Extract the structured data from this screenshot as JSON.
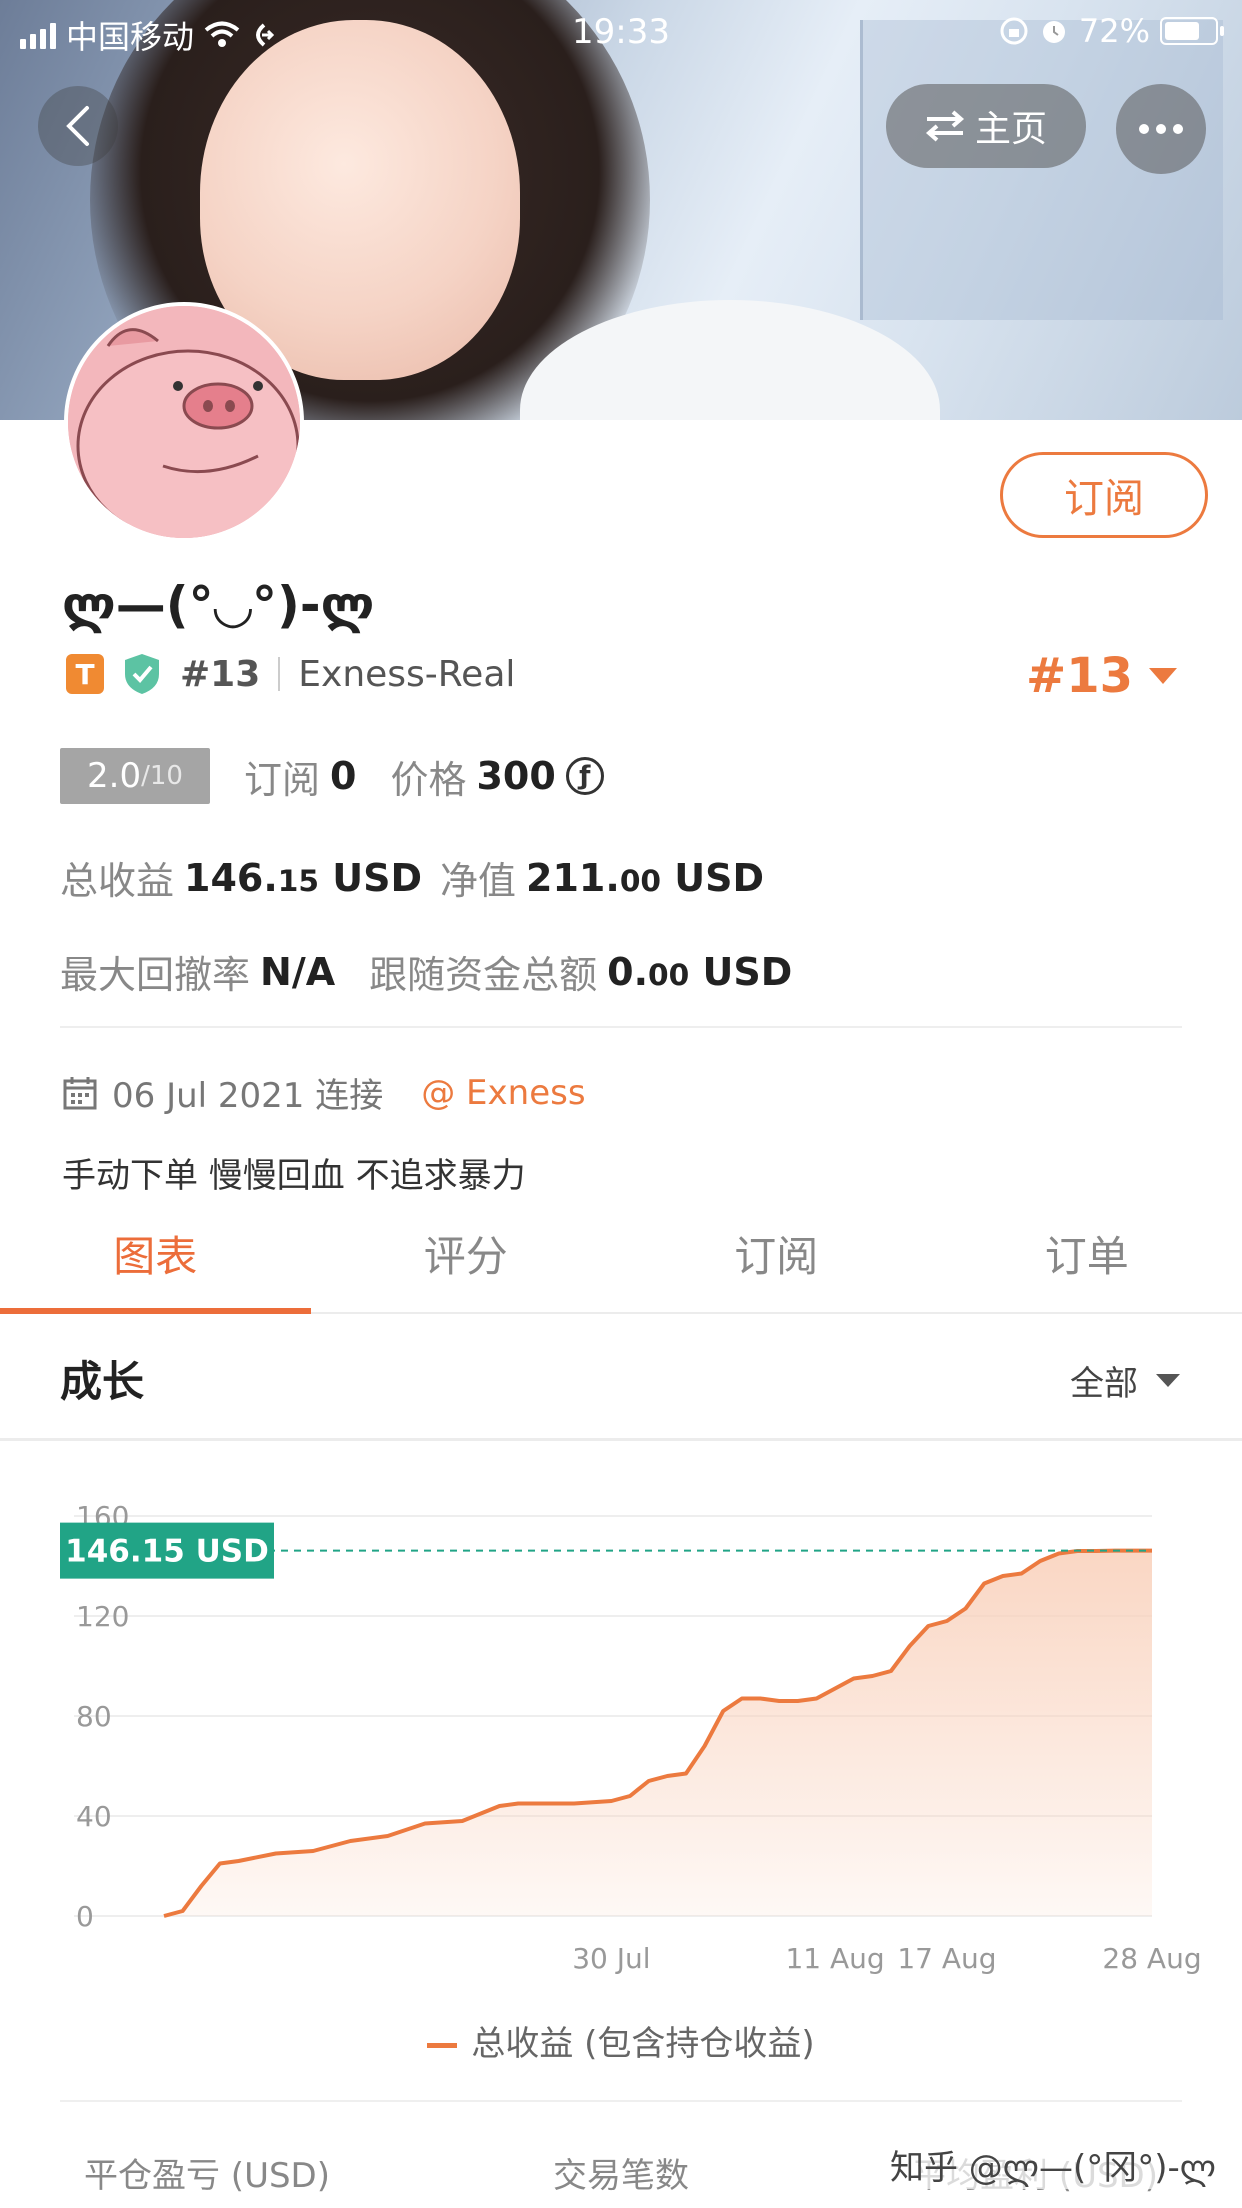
{
  "status_bar": {
    "carrier": "中国移动",
    "time": "19:33",
    "battery": "72%"
  },
  "header": {
    "home_label": "主页"
  },
  "profile": {
    "nickname": "ლ—(°◡°)-ლ",
    "badge_letter": "T",
    "rank": "#13",
    "server": "Exness-Real",
    "rank_big": "#13",
    "subscribe_label": "订阅"
  },
  "stats": {
    "score": "2.0",
    "score_max": "/10",
    "subs_label": "订阅",
    "subs_value": "0",
    "price_label": "价格",
    "price_value": "300",
    "coin_symbol": "ƒ",
    "total_profit_label": "总收益",
    "total_profit_int": "146.",
    "total_profit_dec": "15",
    "total_profit_unit": "USD",
    "equity_label": "净值",
    "equity_int": "211.",
    "equity_dec": "00",
    "equity_unit": "USD",
    "drawdown_label": "最大回撤率",
    "drawdown_value": "N/A",
    "follow_label": "跟随资金总额",
    "follow_int": "0.",
    "follow_dec": "00",
    "follow_unit": "USD"
  },
  "connection": {
    "date_text": "06 Jul 2021 连接",
    "broker": "@ Exness"
  },
  "bio": "手动下单 慢慢回血 不追求暴力",
  "tabs": [
    "图表",
    "评分",
    "订阅",
    "订单"
  ],
  "growth": {
    "title": "成长",
    "filter": "全部"
  },
  "chart_data": {
    "type": "area",
    "current_label": "146.15 USD",
    "current_value": 146.15,
    "ylim": [
      0,
      160
    ],
    "yticks": [
      0,
      40,
      80,
      120,
      160
    ],
    "xticks": [
      {
        "label": "30 Jul",
        "x": 24
      },
      {
        "label": "11 Aug",
        "x": 36
      },
      {
        "label": "17 Aug",
        "x": 42
      },
      {
        "label": "28 Aug",
        "x": 53
      }
    ],
    "xlim": [
      0,
      53
    ],
    "x": [
      0,
      1,
      2,
      3,
      4,
      6,
      8,
      10,
      12,
      14,
      16,
      18,
      19,
      20,
      22,
      24,
      25,
      26,
      27,
      28,
      29,
      30,
      31,
      32,
      33,
      34,
      35,
      36,
      37,
      38,
      39,
      40,
      41,
      42,
      43,
      44,
      45,
      46,
      47,
      48,
      49,
      50,
      51,
      52,
      53
    ],
    "values": [
      0,
      2,
      12,
      21,
      22,
      25,
      26,
      30,
      32,
      37,
      38,
      44,
      45,
      45,
      45,
      46,
      48,
      54,
      56,
      57,
      68,
      82,
      87,
      87,
      86,
      86,
      87,
      91,
      95,
      96,
      98,
      108,
      116,
      118,
      123,
      133,
      136,
      137,
      142,
      145,
      146,
      146,
      146.15,
      146.15,
      146.15
    ],
    "legend": "总收益 (包含持仓收益)",
    "colors": {
      "line": "#ec7a3f",
      "fill": "#f9d2bd",
      "current": "#21a486"
    }
  },
  "bottom_stats": [
    "平仓盈亏 (USD)",
    "交易笔数",
    "平均盈利 (USD)"
  ],
  "watermark": "知乎 @ლ—(°冈°)-ლ"
}
